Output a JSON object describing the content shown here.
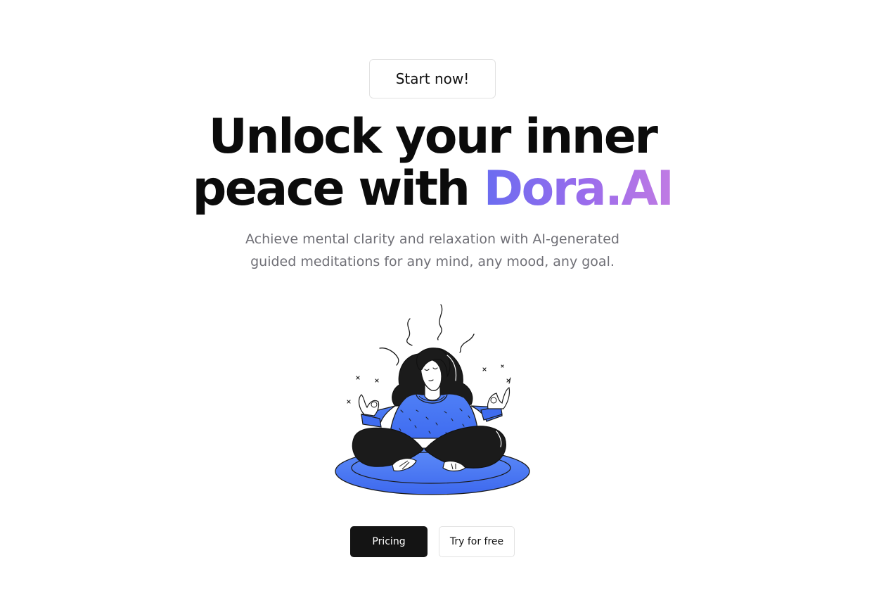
{
  "hero": {
    "badge_label": "Start now!",
    "headline_line1": "Unlock your inner",
    "headline_line2_prefix": "peace with ",
    "headline_brand": "Dora.AI",
    "subtitle_line1": "Achieve mental clarity and relaxation with AI-generated",
    "subtitle_line2": "guided meditations for any mind, any mood, any goal.",
    "illustration_icon": "meditating-woman-illustration"
  },
  "actions": {
    "primary_label": "Pricing",
    "secondary_label": "Try for free"
  },
  "colors": {
    "brand_gradient_start": "#6a6cf0",
    "brand_gradient_end": "#c07be3",
    "primary_button": "#141414",
    "cushion_blue": "#4b7bf5"
  }
}
